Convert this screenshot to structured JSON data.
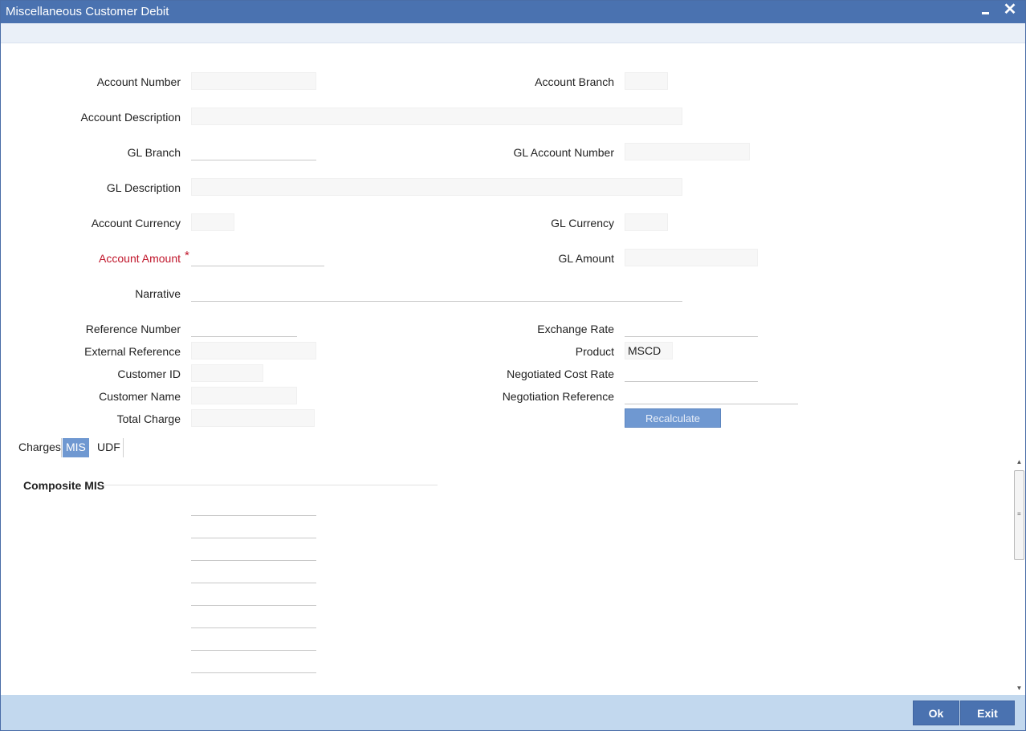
{
  "window": {
    "title": "Miscellaneous Customer Debit",
    "minimize_label": "minimize",
    "close_glyph": "✕"
  },
  "form": {
    "account_number": {
      "label": "Account Number",
      "value": ""
    },
    "account_branch": {
      "label": "Account Branch",
      "value": ""
    },
    "account_description": {
      "label": "Account Description",
      "value": ""
    },
    "gl_branch": {
      "label": "GL Branch",
      "value": ""
    },
    "gl_account_number": {
      "label": "GL Account Number",
      "value": ""
    },
    "gl_description": {
      "label": "GL Description",
      "value": ""
    },
    "account_currency": {
      "label": "Account Currency",
      "value": ""
    },
    "gl_currency": {
      "label": "GL Currency",
      "value": ""
    },
    "account_amount": {
      "label": "Account Amount",
      "required_mark": "*",
      "value": ""
    },
    "gl_amount": {
      "label": "GL Amount",
      "value": ""
    },
    "narrative": {
      "label": "Narrative",
      "value": ""
    },
    "reference_number": {
      "label": "Reference Number",
      "value": ""
    },
    "exchange_rate": {
      "label": "Exchange Rate",
      "value": ""
    },
    "external_reference": {
      "label": "External Reference",
      "value": ""
    },
    "product": {
      "label": "Product",
      "value": "MSCD"
    },
    "customer_id": {
      "label": "Customer ID",
      "value": ""
    },
    "negotiated_cost_rate": {
      "label": "Negotiated Cost Rate",
      "value": ""
    },
    "customer_name": {
      "label": "Customer Name",
      "value": ""
    },
    "negotiation_reference": {
      "label": "Negotiation Reference",
      "value": ""
    },
    "total_charge": {
      "label": "Total Charge",
      "value": ""
    },
    "recalculate_label": "Recalculate"
  },
  "tabs": [
    {
      "label": "Charges",
      "active": false
    },
    {
      "label": "MIS",
      "active": true
    },
    {
      "label": "UDF",
      "active": false
    }
  ],
  "mis": {
    "section_title": "Composite MIS",
    "fields": [
      "",
      "",
      "",
      "",
      "",
      "",
      "",
      ""
    ]
  },
  "footer": {
    "ok_label": "Ok",
    "exit_label": "Exit"
  },
  "colors": {
    "titlebar": "#4a72b0",
    "required": "#c0162b",
    "button": "#4a72b0",
    "active_tab": "#6f98d1",
    "footer": "#c2d8ee"
  }
}
